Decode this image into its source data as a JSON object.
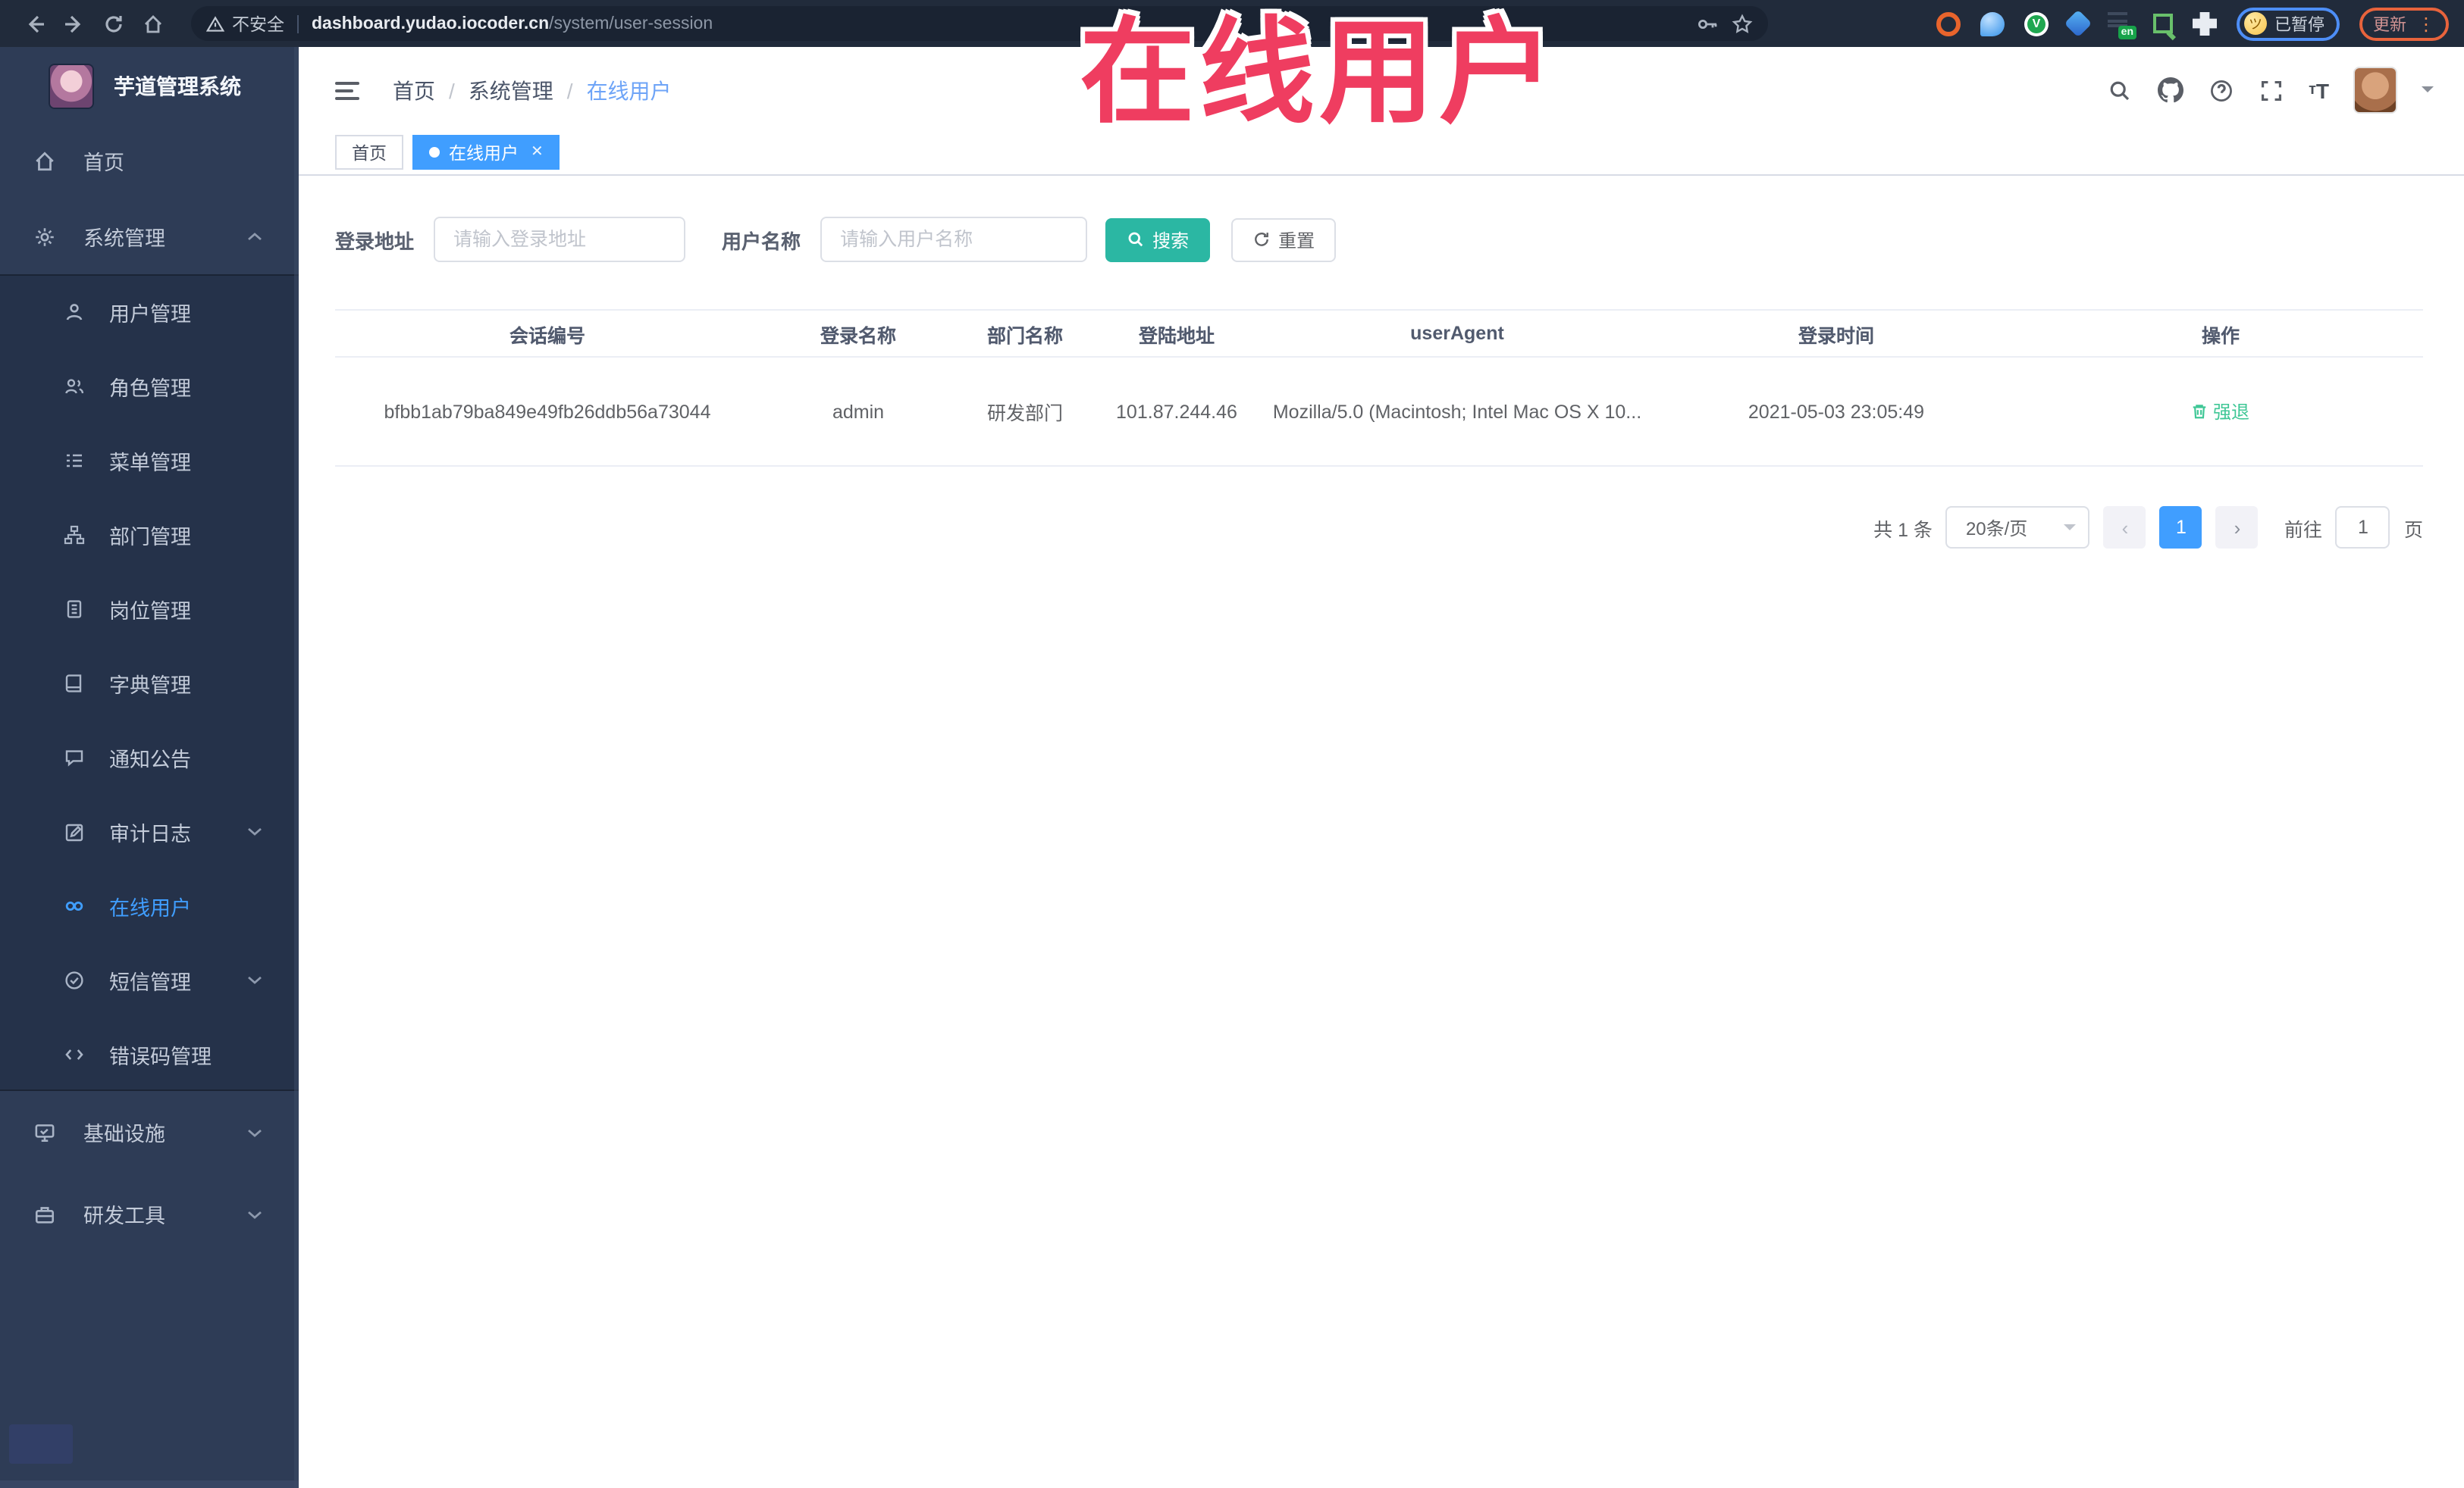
{
  "browser": {
    "security_label": "不安全",
    "url_host": "dashboard.yudao.iocoder.cn",
    "url_path": "/system/user-session",
    "extension_badge": "en",
    "paused_badge": "已暂停",
    "update_button": "更新"
  },
  "watermark": "在线用户",
  "sidebar": {
    "app_title": "芋道管理系统",
    "home": "首页",
    "system_group": "系统管理",
    "system_children": [
      "用户管理",
      "角色管理",
      "菜单管理",
      "部门管理",
      "岗位管理",
      "字典管理",
      "通知公告",
      "审计日志",
      "在线用户",
      "短信管理",
      "错误码管理"
    ],
    "infra_group": "基础设施",
    "dev_group": "研发工具"
  },
  "breadcrumb": [
    "首页",
    "系统管理",
    "在线用户"
  ],
  "tabs": [
    {
      "label": "首页"
    },
    {
      "label": "在线用户"
    }
  ],
  "filters": {
    "address_label": "登录地址",
    "address_placeholder": "请输入登录地址",
    "name_label": "用户名称",
    "name_placeholder": "请输入用户名称",
    "search_button": "搜索",
    "reset_button": "重置"
  },
  "table": {
    "columns": [
      "会话编号",
      "登录名称",
      "部门名称",
      "登陆地址",
      "userAgent",
      "登录时间",
      "操作"
    ],
    "row": {
      "session_id": "bfbb1ab79ba849e49fb26ddb56a73044",
      "login_name": "admin",
      "dept_name": "研发部门",
      "login_ip": "101.87.244.46",
      "user_agent": "Mozilla/5.0 (Macintosh; Intel Mac OS X 10...",
      "login_time": "2021-05-03 23:05:49",
      "action": "强退"
    }
  },
  "pagination": {
    "total": "共 1 条",
    "page_size": "20条/页",
    "page": "1",
    "goto_label": "前往",
    "goto_value": "1",
    "page_unit": "页"
  },
  "colors": {
    "accent": "#409eff",
    "search_button": "#2bb7a3",
    "action_link": "#3fc796",
    "watermark": "#ef3d60",
    "sidebar_bg": "#2e3c56",
    "submenu_bg": "#25324a"
  }
}
